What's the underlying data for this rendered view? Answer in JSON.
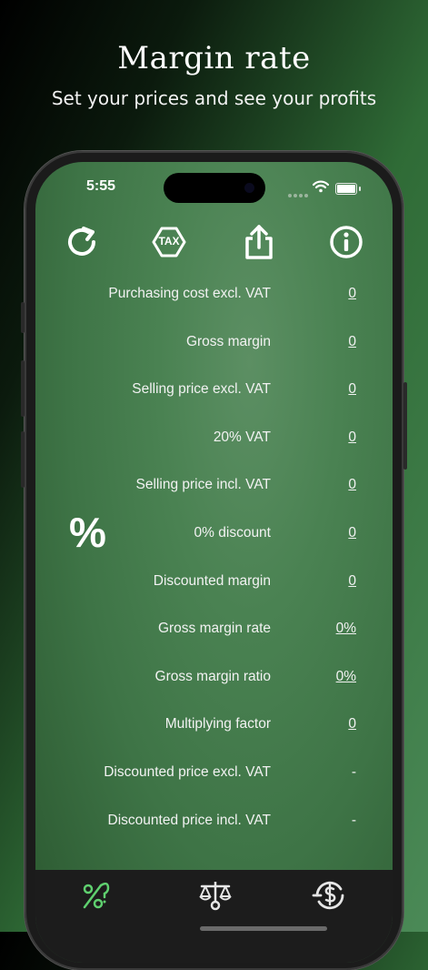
{
  "promo": {
    "title": "Margin rate",
    "subtitle": "Set your prices and see your profits"
  },
  "status_bar": {
    "time": "5:55"
  },
  "toolbar": {
    "icons": [
      "refresh-icon",
      "tax-icon",
      "share-icon",
      "info-icon"
    ],
    "tax_badge": "TAX"
  },
  "symbol": "%",
  "rows": [
    {
      "label": "Purchasing cost excl. VAT",
      "value": "0"
    },
    {
      "label": "Gross margin",
      "value": "0"
    },
    {
      "label": "Selling price excl. VAT",
      "value": "0"
    },
    {
      "label": "20% VAT",
      "value": "0"
    },
    {
      "label": "Selling price incl. VAT",
      "value": "0"
    },
    {
      "label": "0% discount",
      "value": "0"
    },
    {
      "label": "Discounted margin",
      "value": "0"
    },
    {
      "label": "Gross margin rate",
      "value": "0%"
    },
    {
      "label": "Gross margin ratio",
      "value": "0%"
    },
    {
      "label": "Multiplying factor",
      "value": "0"
    },
    {
      "label": "Discounted price excl. VAT",
      "value": "-"
    },
    {
      "label": "Discounted price incl. VAT",
      "value": "-"
    }
  ],
  "tabs": {
    "icons": [
      "margin-percent-icon",
      "scale-icon",
      "dollar-cycle-icon"
    ],
    "active_color": "#5fd06f",
    "inactive_color": "#e6e6e6"
  },
  "colors": {
    "screen_green": "#4a8252",
    "tabbar": "#1c1c1c"
  }
}
